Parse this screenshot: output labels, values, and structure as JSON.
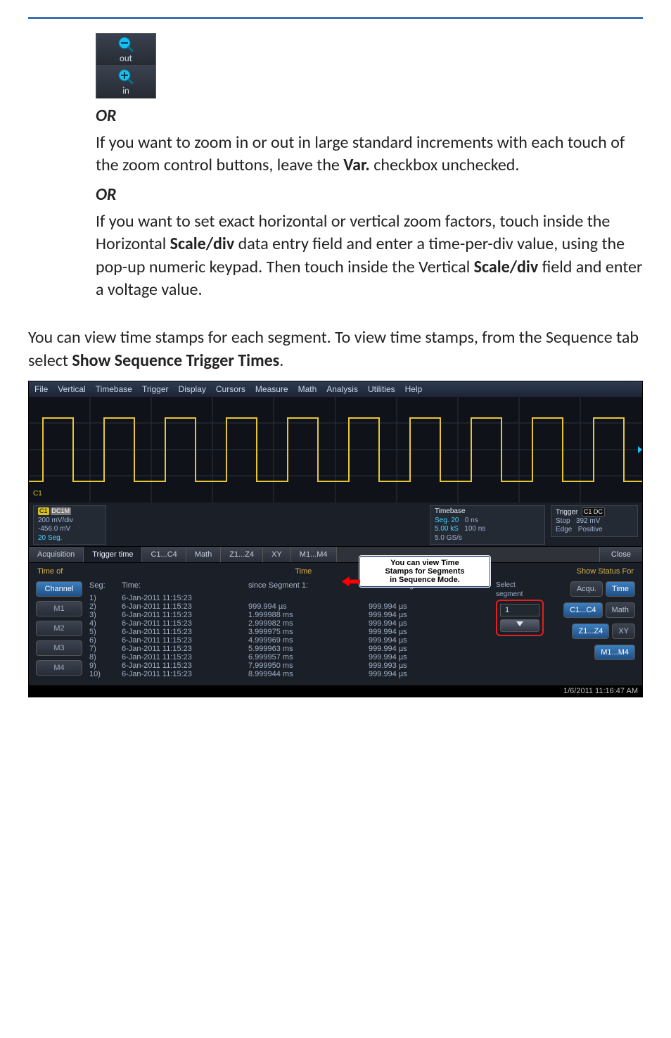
{
  "zoom_buttons": {
    "out_label": "out",
    "in_label": "in"
  },
  "or_label": "OR",
  "paragraphs": {
    "p1a": "If you want to zoom in or out in large standard increments with each touch of the zoom control buttons, leave the ",
    "p1_bold": "Var.",
    "p1b": " checkbox unchecked.",
    "p2a": "If you want to set exact horizontal or vertical zoom factors, touch inside the Horizontal ",
    "p2_bold1": "Scale/div",
    "p2b": " data entry field and enter a time-per-div value, using the pop-up numeric keypad. Then touch inside the Vertical ",
    "p2_bold2": "Scale/div",
    "p2c": " field and enter a voltage value.",
    "p3a": "You can view time stamps for each segment. To view time stamps, from the Sequence tab select ",
    "p3_bold": "Show Sequence Trigger Times",
    "p3b": "."
  },
  "scope": {
    "menubar": [
      "File",
      "Vertical",
      "Timebase",
      "Trigger",
      "Display",
      "Cursors",
      "Measure",
      "Math",
      "Analysis",
      "Utilities",
      "Help"
    ],
    "channel_box": {
      "badge_ch": "C1",
      "badge_coupling": "DC1M",
      "line1": "200 mV/div",
      "line2": "-456.0 mV",
      "line3": "20 Seg."
    },
    "timebase_box": {
      "title": "Timebase",
      "v1a": "Seg.  20",
      "v1b": "0 ns",
      "v2a": "5.00 kS",
      "v2b": "100 ns",
      "v3": "5.0 GS/s"
    },
    "trigger_box": {
      "title": "Trigger",
      "badge": "C1 DC",
      "line1": "Stop",
      "line1r": "392 mV",
      "line2": "Edge",
      "line2r": "Positive"
    },
    "tabs": {
      "items": [
        "Acquisition",
        "Trigger time",
        "C1...C4",
        "Math",
        "Z1...Z4",
        "XY",
        "M1...M4"
      ],
      "close": "Close"
    },
    "subbar": {
      "timeof": "Time of",
      "time": "Time",
      "status": "Show Status For"
    },
    "left_chips": [
      "Channel",
      "M1",
      "M2",
      "M3",
      "M4"
    ],
    "table": {
      "headers": {
        "seg": "Seg:",
        "time": "Time:",
        "since": "since Segment 1:",
        "between": "between Segment"
      },
      "rows": [
        {
          "seg": "1)",
          "time": "6-Jan-2011 11:15:23",
          "since": "",
          "between": ""
        },
        {
          "seg": "2)",
          "time": "6-Jan-2011 11:15:23",
          "since": "999.994 µs",
          "between": "999.994 µs"
        },
        {
          "seg": "3)",
          "time": "6-Jan-2011 11:15:23",
          "since": "1.999988 ms",
          "between": "999.994 µs"
        },
        {
          "seg": "4)",
          "time": "6-Jan-2011 11:15:23",
          "since": "2.999982 ms",
          "between": "999.994 µs"
        },
        {
          "seg": "5)",
          "time": "6-Jan-2011 11:15:23",
          "since": "3.999975 ms",
          "between": "999.994 µs"
        },
        {
          "seg": "6)",
          "time": "6-Jan-2011 11:15:23",
          "since": "4.999969 ms",
          "between": "999.994 µs"
        },
        {
          "seg": "7)",
          "time": "6-Jan-2011 11:15:23",
          "since": "5.999963 ms",
          "between": "999.994 µs"
        },
        {
          "seg": "8)",
          "time": "6-Jan-2011 11:15:23",
          "since": "6.999957 ms",
          "between": "999.994 µs"
        },
        {
          "seg": "9)",
          "time": "6-Jan-2011 11:15:23",
          "since": "7.999950 ms",
          "between": "999.993 µs"
        },
        {
          "seg": "10)",
          "time": "6-Jan-2011 11:15:23",
          "since": "8.999944 ms",
          "between": "999.994 µs"
        }
      ]
    },
    "segment_selector": {
      "label_a": "Select",
      "label_b": "segment",
      "value": "1"
    },
    "right_buttons": {
      "acqu": "Acqu.",
      "time": "Time",
      "c14": "C1...C4",
      "math": "Math",
      "z14": "Z1...Z4",
      "xy": "XY",
      "m14": "M1...M4"
    },
    "callout": {
      "l1": "You can view Time",
      "l2": "Stamps for Segments",
      "l3": "in Sequence Mode."
    },
    "statusbar": "1/6/2011 11:16:47 AM"
  }
}
